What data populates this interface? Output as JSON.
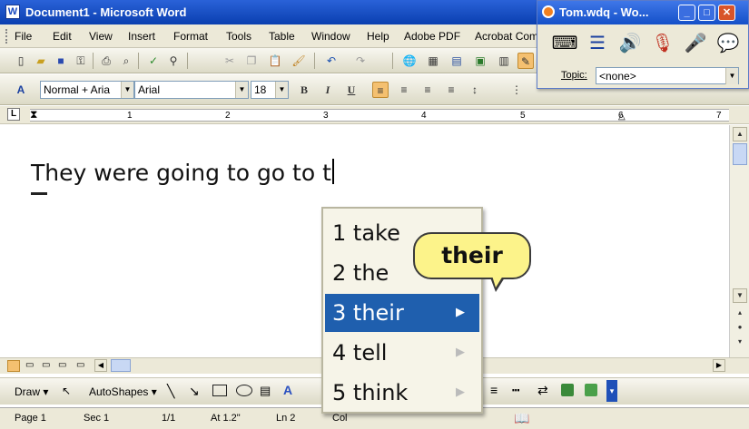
{
  "window": {
    "title": "Document1 - Microsoft Word",
    "app_icon": "W"
  },
  "menu": [
    "File",
    "Edit",
    "View",
    "Insert",
    "Format",
    "Tools",
    "Table",
    "Window",
    "Help",
    "Adobe PDF",
    "Acrobat Com"
  ],
  "format_bar": {
    "style": "Normal + Aria",
    "font": "Arial",
    "size": "18",
    "bold": "B",
    "italic": "I",
    "underline": "U"
  },
  "ruler": {
    "marks": [
      "1",
      "2",
      "3",
      "4",
      "5",
      "6",
      "7"
    ]
  },
  "document": {
    "text": "They were going to go to t"
  },
  "prediction": {
    "items": [
      {
        "num": "1",
        "word": "take"
      },
      {
        "num": "2",
        "word": "the"
      },
      {
        "num": "3",
        "word": "their"
      },
      {
        "num": "4",
        "word": "tell"
      },
      {
        "num": "5",
        "word": "think"
      }
    ],
    "selected_index": 2,
    "bubble": "their"
  },
  "float_toolbar": {
    "title": "Tom.wdq - Wo...",
    "topic_label": "Topic:",
    "topic_value": "<none>"
  },
  "draw_bar": {
    "draw": "Draw",
    "autoshapes": "AutoShapes"
  },
  "status": {
    "page": "Page 1",
    "sec": "Sec 1",
    "pages": "1/1",
    "at": "At 1.2\"",
    "ln": "Ln 2",
    "col": "Col"
  },
  "colors": {
    "titlebar": "#0a3fb0",
    "selection": "#1f5fae",
    "bubble": "#fcf38a",
    "chrome": "#ece9d8"
  }
}
